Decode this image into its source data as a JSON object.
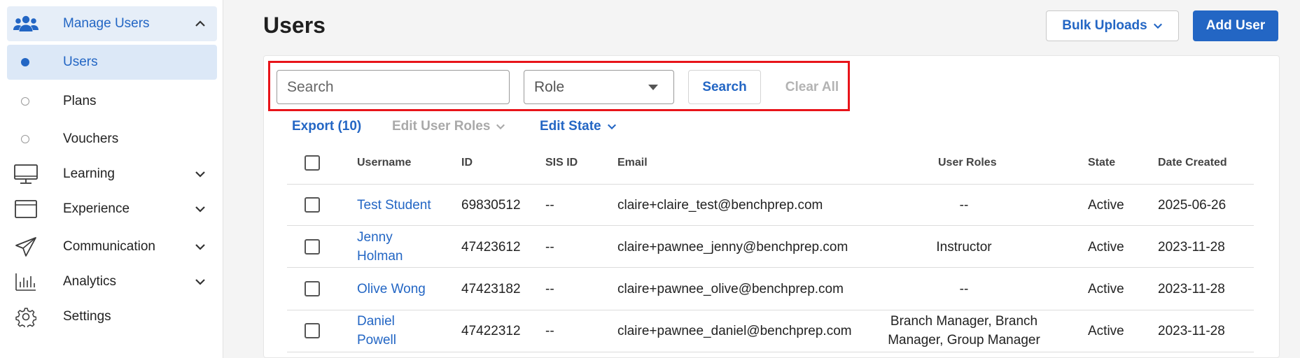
{
  "sidebar": {
    "manage_users": "Manage Users",
    "users": "Users",
    "plans": "Plans",
    "vouchers": "Vouchers",
    "learning": "Learning",
    "experience": "Experience",
    "communication": "Communication",
    "analytics": "Analytics",
    "settings": "Settings"
  },
  "header": {
    "title": "Users",
    "bulk_uploads": "Bulk Uploads",
    "add_user": "Add User"
  },
  "filters": {
    "search_placeholder": "Search",
    "role_placeholder": "Role",
    "search_button": "Search",
    "clear_all": "Clear All"
  },
  "actions": {
    "export": "Export (10)",
    "edit_user_roles": "Edit User Roles",
    "edit_state": "Edit State"
  },
  "table": {
    "headers": {
      "username": "Username",
      "id": "ID",
      "sis_id": "SIS ID",
      "email": "Email",
      "user_roles": "User Roles",
      "state": "State",
      "date_created": "Date Created"
    },
    "rows": [
      {
        "username_1": "Test Student",
        "username_2": "",
        "id": "69830512",
        "sis_id": "--",
        "email": "claire+claire_test@benchprep.com",
        "roles_1": "--",
        "roles_2": "",
        "state": "Active",
        "date": "2025-06-26"
      },
      {
        "username_1": "Jenny",
        "username_2": "Holman",
        "id": "47423612",
        "sis_id": "--",
        "email": "claire+pawnee_jenny@benchprep.com",
        "roles_1": "Instructor",
        "roles_2": "",
        "state": "Active",
        "date": "2023-11-28"
      },
      {
        "username_1": "Olive Wong",
        "username_2": "",
        "id": "47423182",
        "sis_id": "--",
        "email": "claire+pawnee_olive@benchprep.com",
        "roles_1": "--",
        "roles_2": "",
        "state": "Active",
        "date": "2023-11-28"
      },
      {
        "username_1": "Daniel",
        "username_2": "Powell",
        "id": "47422312",
        "sis_id": "--",
        "email": "claire+pawnee_daniel@benchprep.com",
        "roles_1": "Branch Manager, Branch",
        "roles_2": "Manager, Group Manager",
        "state": "Active",
        "date": "2023-11-28"
      }
    ]
  },
  "colors": {
    "accent": "#2366c4",
    "highlight": "#e8141a"
  }
}
